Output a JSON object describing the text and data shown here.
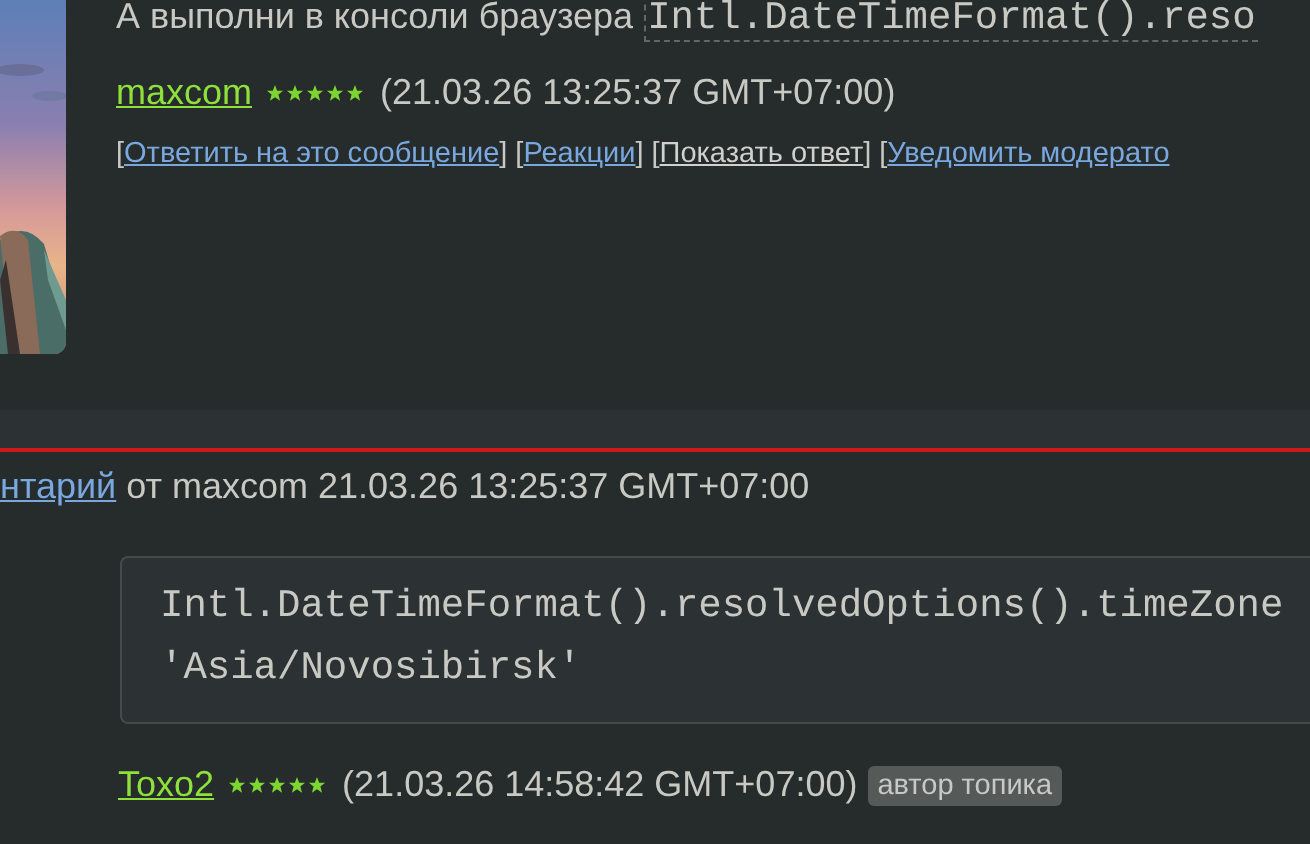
{
  "post": {
    "text": "А выполни в консоли браузера",
    "code": "Intl.DateTimeFormat().reso",
    "author": {
      "name": "maxcom",
      "stars": 5,
      "time": "(21.03.26 13:25:37 GMT+07:00)"
    },
    "links": [
      {
        "prefix": "[",
        "label": "Ответить на это сообщение",
        "suffix": "]",
        "visited": false
      },
      {
        "prefix": "[",
        "label": "Реакции",
        "suffix": "]",
        "visited": false
      },
      {
        "prefix": "[",
        "label": "Показать ответ",
        "suffix": "]",
        "visited": true
      },
      {
        "prefix": "[",
        "label": "Уведомить модерато",
        "visited": false
      }
    ]
  },
  "reply": {
    "ref_link": "нтарий",
    "ref_text": "от maxcom 21.03.26 13:25:37 GMT+07:00",
    "code_lines": [
      "Intl.DateTimeFormat().resolvedOptions().timeZone",
      "'Asia/Novosibirsk'"
    ],
    "author": {
      "name": "Toxo2",
      "stars": 5,
      "time": "(21.03.26 14:58:42 GMT+07:00)",
      "badge": "автор топика"
    }
  }
}
